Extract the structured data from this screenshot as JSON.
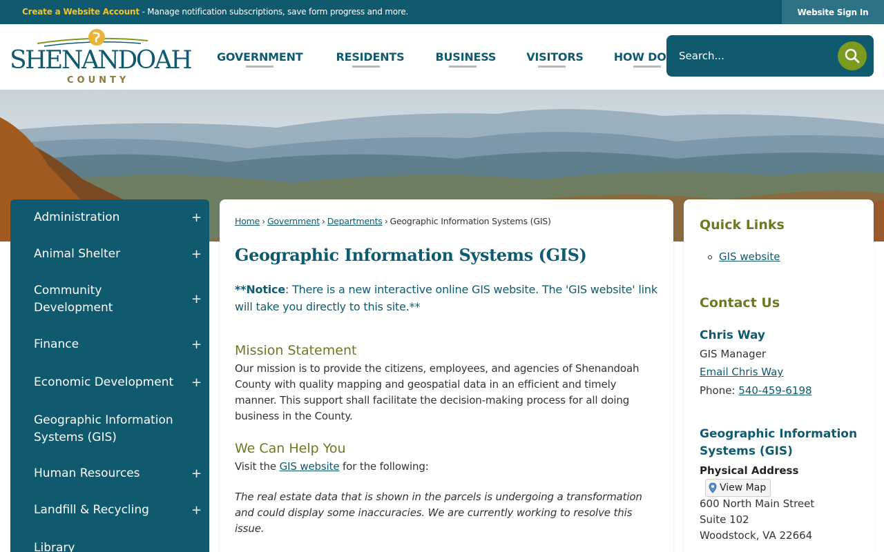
{
  "topbar": {
    "create_account": "Create a Website Account",
    "notice_rest": " - Manage notification subscriptions, save form progress and more.",
    "sign_in": "Website Sign In"
  },
  "logo": {
    "name": "SHENANDOAH",
    "county": "COUNTY"
  },
  "nav": [
    "GOVERNMENT",
    "RESIDENTS",
    "BUSINESS",
    "VISITORS",
    "HOW DO I..."
  ],
  "search": {
    "placeholder": "Search..."
  },
  "sidebar": {
    "items": [
      {
        "label": "Administration",
        "plus": "+"
      },
      {
        "label": "Animal Shelter",
        "plus": "+"
      },
      {
        "label": "Community Development",
        "plus": "+"
      },
      {
        "label": "Finance",
        "plus": "+"
      },
      {
        "label": "Economic Development",
        "plus": "+"
      },
      {
        "label": "Geographic Information Systems (GIS)",
        "plus": ""
      },
      {
        "label": "Human Resources",
        "plus": "+"
      },
      {
        "label": "Landfill & Recycling",
        "plus": "+"
      },
      {
        "label": "Library",
        "plus": ""
      }
    ]
  },
  "breadcrumb": {
    "home": "Home",
    "government": "Government",
    "departments": "Departments",
    "current": "Geographic Information Systems (GIS)",
    "separator": "›"
  },
  "main": {
    "title": "Geographic Information Systems (GIS)",
    "notice_bold": "**Notice",
    "notice_text": ": There is a new interactive online GIS website. The 'GIS website' link will take you directly to this site.**",
    "mission_heading": "Mission Statement",
    "mission_text": "Our mission is to provide the citizens, employees, and agencies of Shenandoah County with quality mapping and geospatial data in an efficient and timely manner. This support shall facilitate the decision-making process for all doing business in the County.",
    "help_heading": "We Can Help You",
    "help_prefix": "Visit the ",
    "help_link": "GIS website",
    "help_suffix": " for the following:",
    "disclaimer": "The real estate data that is shown in the parcels is undergoing a transformation and could display some inaccuracies. We are currently working to resolve this issue."
  },
  "right": {
    "quick_links_heading": "Quick Links",
    "quick_link": "GIS website",
    "contact_heading": "Contact Us",
    "contact_name": "Chris Way",
    "contact_title": "GIS Manager",
    "contact_email": "Email Chris Way",
    "phone_label": "Phone: ",
    "phone": "540-459-6198",
    "dept_name": "Geographic Information Systems (GIS)",
    "address_label": "Physical Address",
    "view_map": "View Map",
    "street": "600 North Main Street",
    "suite": "Suite 102",
    "city": "Woodstock, VA 22664"
  },
  "colors": {
    "brand_teal": "#0f5a6e",
    "accent_green": "#6b7a22",
    "search_button": "#7b9a1f",
    "account_link": "#f2c12e"
  }
}
